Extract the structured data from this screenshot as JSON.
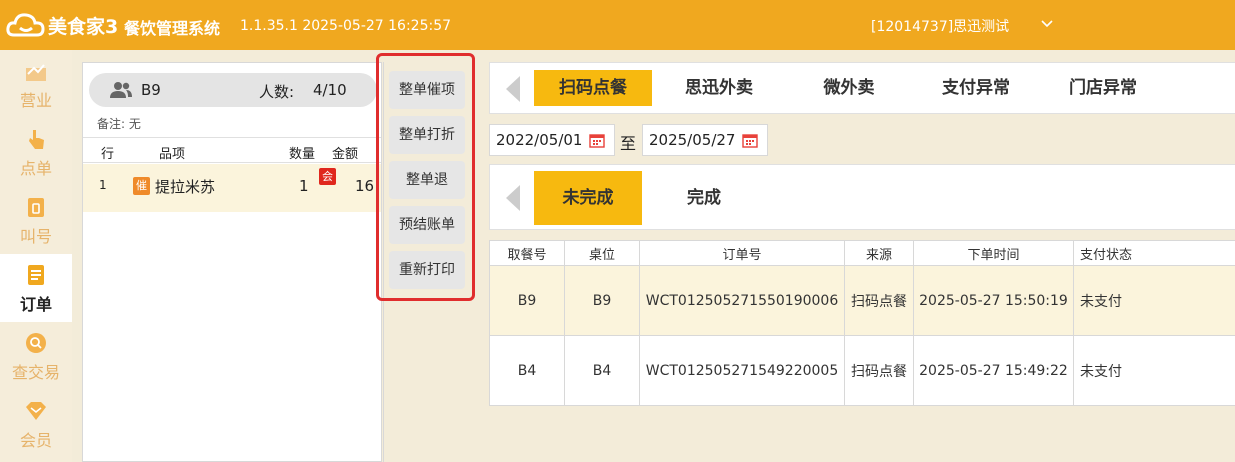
{
  "app": {
    "logo_text": "美食家3",
    "title": "餐饮管理系统",
    "version": "1.1.35.1 2025-05-27 16:25:57",
    "account": "[12014737]思迅测试",
    "accent_color": "#f0a81f"
  },
  "nav": [
    {
      "label": "营业",
      "icon": "chart-icon"
    },
    {
      "label": "点单",
      "icon": "hand-pointer-icon"
    },
    {
      "label": "叫号",
      "icon": "number-ticket-icon"
    },
    {
      "label": "订单",
      "icon": "order-list-icon"
    },
    {
      "label": "查交易",
      "icon": "search-transaction-icon"
    },
    {
      "label": "会员",
      "icon": "member-diamond-icon"
    }
  ],
  "order": {
    "table": "B9",
    "people_label": "人数:",
    "people": "4/10",
    "note": "备注: 无",
    "columns": {
      "row": "行",
      "item": "品项",
      "qty": "数量",
      "amount": "金额"
    },
    "items": [
      {
        "row": "1",
        "urge_badge": "催",
        "name": "提拉米苏",
        "qty": "1",
        "member_badge": "会",
        "amount": "16"
      }
    ]
  },
  "actions": [
    "整单催项",
    "整单打折",
    "整单退",
    "预结账单",
    "重新打印"
  ],
  "tabs": [
    "扫码点餐",
    "思迅外卖",
    "微外卖",
    "支付异常",
    "门店异常"
  ],
  "date_from": "2022/05/01",
  "date_sep": "至",
  "date_to": "2025/05/27",
  "status_tabs": [
    "未完成",
    "完成"
  ],
  "grid": {
    "headers": [
      "取餐号",
      "桌位",
      "订单号",
      "来源",
      "下单时间",
      "支付状态"
    ],
    "rows": [
      [
        "B9",
        "B9",
        "WCT012505271550190006",
        "扫码点餐",
        "2025-05-27 15:50:19",
        "未支付"
      ],
      [
        "B4",
        "B4",
        "WCT012505271549220005",
        "扫码点餐",
        "2025-05-27 15:49:22",
        "未支付"
      ]
    ]
  }
}
